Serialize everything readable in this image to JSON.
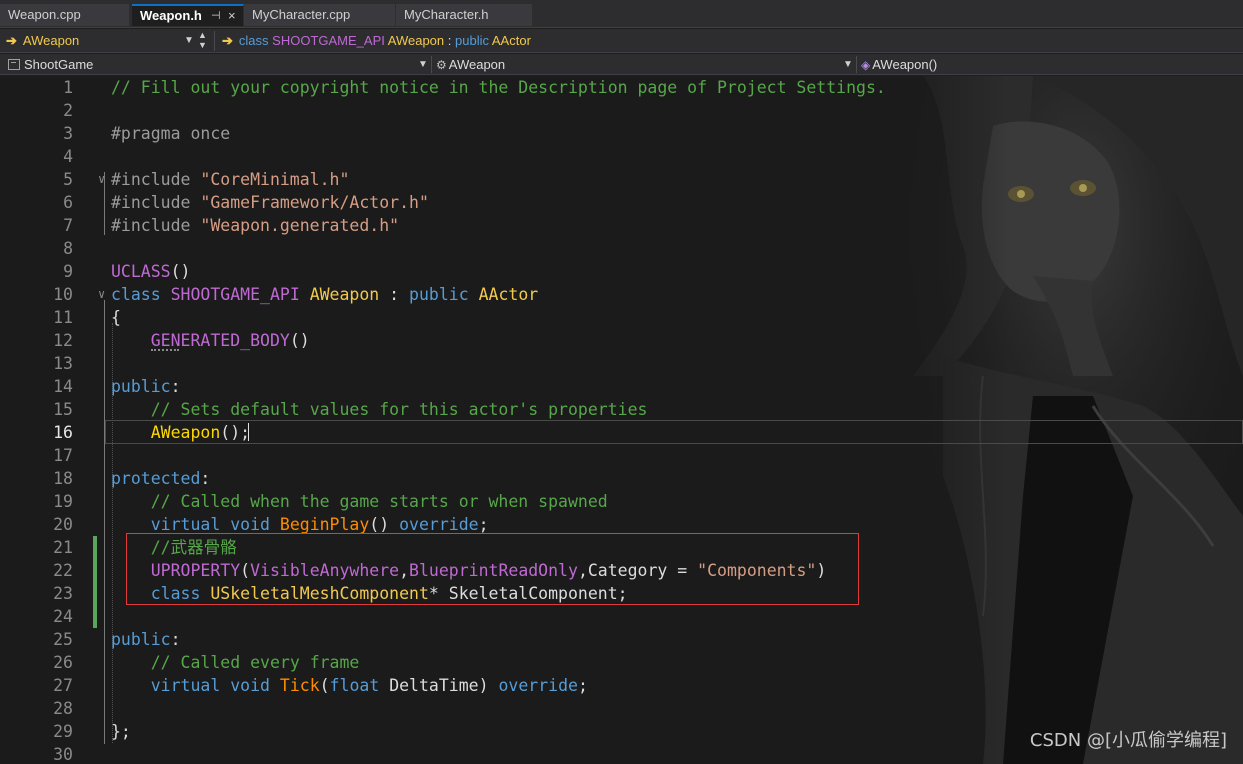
{
  "tabs": [
    {
      "label": "Weapon.cpp",
      "active": false
    },
    {
      "label": "Weapon.h",
      "active": true,
      "pin": "⊣",
      "close": "×"
    },
    {
      "label": "MyCharacter.cpp",
      "active": false
    },
    {
      "label": "MyCharacter.h",
      "active": false
    }
  ],
  "navbar": {
    "scope_combo": "AWeapon",
    "breadcrumb": {
      "kw_class": "class",
      "api": "SHOOTGAME_API",
      "name": "AWeapon",
      "colon": ":",
      "kw_public": "public",
      "base": "AActor"
    },
    "project_combo": "ShootGame",
    "class_combo": "AWeapon",
    "member_combo": "AWeapon()"
  },
  "editor": {
    "current_line": 16,
    "lines": [
      {
        "n": "1",
        "tokens": [
          {
            "c": "c-com",
            "t": "// Fill out your copyright notice in the Description page of Project Settings."
          }
        ]
      },
      {
        "n": "2",
        "tokens": []
      },
      {
        "n": "3",
        "tokens": [
          {
            "c": "c-pre",
            "t": "#pragma once"
          }
        ]
      },
      {
        "n": "4",
        "tokens": []
      },
      {
        "n": "5",
        "fold": "∨",
        "tokens": [
          {
            "c": "c-pre",
            "t": "#include "
          },
          {
            "c": "c-str",
            "t": "\"CoreMinimal.h\""
          }
        ]
      },
      {
        "n": "6",
        "tokens": [
          {
            "c": "c-pre",
            "t": "#include "
          },
          {
            "c": "c-str",
            "t": "\"GameFramework/Actor.h\""
          }
        ]
      },
      {
        "n": "7",
        "tokens": [
          {
            "c": "c-pre",
            "t": "#include "
          },
          {
            "c": "c-str",
            "t": "\"Weapon.generated.h\""
          }
        ]
      },
      {
        "n": "8",
        "tokens": []
      },
      {
        "n": "9",
        "tokens": [
          {
            "c": "c-mac",
            "t": "UCLASS"
          },
          {
            "c": "c-txt",
            "t": "()"
          }
        ]
      },
      {
        "n": "10",
        "fold": "∨",
        "tokens": [
          {
            "c": "c-kw",
            "t": "class "
          },
          {
            "c": "c-mac",
            "t": "SHOOTGAME_API "
          },
          {
            "c": "c-typ",
            "t": "AWeapon "
          },
          {
            "c": "c-txt",
            "t": ": "
          },
          {
            "c": "c-kw",
            "t": "public "
          },
          {
            "c": "c-typ",
            "t": "AActor"
          }
        ]
      },
      {
        "n": "11",
        "tokens": [
          {
            "c": "c-txt",
            "t": "{"
          }
        ]
      },
      {
        "n": "12",
        "tokens": [
          {
            "c": "c-txt",
            "t": "    "
          },
          {
            "c": "c-mac",
            "t": "GENERATED_BODY"
          },
          {
            "c": "c-txt",
            "t": "()"
          }
        ]
      },
      {
        "n": "13",
        "tokens": []
      },
      {
        "n": "14",
        "tokens": [
          {
            "c": "c-kw",
            "t": "public"
          },
          {
            "c": "c-txt",
            "t": ":"
          }
        ]
      },
      {
        "n": "15",
        "tokens": [
          {
            "c": "c-txt",
            "t": "    "
          },
          {
            "c": "c-com",
            "t": "// Sets default values for this actor's properties"
          }
        ]
      },
      {
        "n": "16",
        "tokens": [
          {
            "c": "c-txt",
            "t": "    "
          },
          {
            "c": "c-fn",
            "t": "AWeapon"
          },
          {
            "c": "c-txt",
            "t": "();"
          }
        ]
      },
      {
        "n": "17",
        "tokens": []
      },
      {
        "n": "18",
        "tokens": [
          {
            "c": "c-kw",
            "t": "protected"
          },
          {
            "c": "c-txt",
            "t": ":"
          }
        ]
      },
      {
        "n": "19",
        "tokens": [
          {
            "c": "c-txt",
            "t": "    "
          },
          {
            "c": "c-com",
            "t": "// Called when the game starts or when spawned"
          }
        ]
      },
      {
        "n": "20",
        "tokens": [
          {
            "c": "c-txt",
            "t": "    "
          },
          {
            "c": "c-kw",
            "t": "virtual void "
          },
          {
            "c": "c-par",
            "t": "BeginPlay"
          },
          {
            "c": "c-txt",
            "t": "() "
          },
          {
            "c": "c-kw",
            "t": "override"
          },
          {
            "c": "c-txt",
            "t": ";"
          }
        ]
      },
      {
        "n": "21",
        "tokens": [
          {
            "c": "c-txt",
            "t": "    "
          },
          {
            "c": "c-com",
            "t": "//武器骨骼"
          }
        ]
      },
      {
        "n": "22",
        "tokens": [
          {
            "c": "c-txt",
            "t": "    "
          },
          {
            "c": "c-mac",
            "t": "UPROPERTY"
          },
          {
            "c": "c-txt",
            "t": "("
          },
          {
            "c": "c-mac",
            "t": "VisibleAnywhere"
          },
          {
            "c": "c-txt",
            "t": ","
          },
          {
            "c": "c-mac",
            "t": "BlueprintReadOnly"
          },
          {
            "c": "c-txt",
            "t": ",Category = "
          },
          {
            "c": "c-str",
            "t": "\"Components\""
          },
          {
            "c": "c-txt",
            "t": ")"
          }
        ]
      },
      {
        "n": "23",
        "tokens": [
          {
            "c": "c-txt",
            "t": "    "
          },
          {
            "c": "c-kw",
            "t": "class "
          },
          {
            "c": "c-typ",
            "t": "USkeletalMeshComponent"
          },
          {
            "c": "c-txt",
            "t": "* SkeletalComponent;"
          }
        ]
      },
      {
        "n": "24",
        "tokens": []
      },
      {
        "n": "25",
        "tokens": [
          {
            "c": "c-kw",
            "t": "public"
          },
          {
            "c": "c-txt",
            "t": ":"
          }
        ]
      },
      {
        "n": "26",
        "tokens": [
          {
            "c": "c-txt",
            "t": "    "
          },
          {
            "c": "c-com",
            "t": "// Called every frame"
          }
        ]
      },
      {
        "n": "27",
        "tokens": [
          {
            "c": "c-txt",
            "t": "    "
          },
          {
            "c": "c-kw",
            "t": "virtual void "
          },
          {
            "c": "c-par",
            "t": "Tick"
          },
          {
            "c": "c-txt",
            "t": "("
          },
          {
            "c": "c-kw",
            "t": "float "
          },
          {
            "c": "c-txt",
            "t": "DeltaTime) "
          },
          {
            "c": "c-kw",
            "t": "override"
          },
          {
            "c": "c-txt",
            "t": ";"
          }
        ]
      },
      {
        "n": "28",
        "tokens": []
      },
      {
        "n": "29",
        "tokens": [
          {
            "c": "c-txt",
            "t": "};"
          }
        ]
      },
      {
        "n": "30",
        "tokens": []
      }
    ]
  },
  "watermark": "CSDN @[小瓜偷学编程]",
  "colors": {
    "accent": "#0e70c0",
    "highlight_box": "#e03b3b",
    "change_bar": "#58a65c"
  }
}
